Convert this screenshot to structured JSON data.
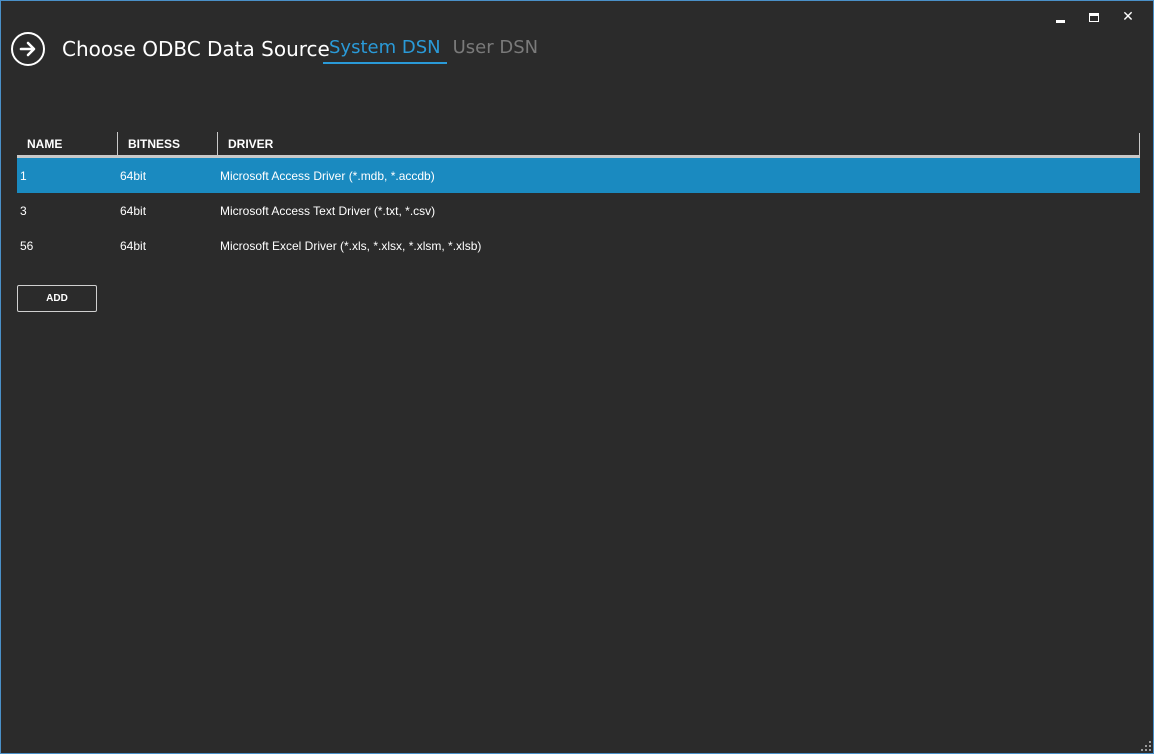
{
  "window": {
    "controls": {
      "minimize": "minimize",
      "maximize": "maximize",
      "close": "✕"
    }
  },
  "header": {
    "title": "Choose ODBC Data Source",
    "tabs": [
      {
        "label": "System DSN",
        "active": true
      },
      {
        "label": "User DSN",
        "active": false
      }
    ]
  },
  "table": {
    "columns": [
      "NAME",
      "BITNESS",
      "DRIVER"
    ],
    "rows": [
      {
        "name": "1",
        "bitness": "64bit",
        "driver": "Microsoft Access Driver (*.mdb, *.accdb)",
        "selected": true
      },
      {
        "name": "3",
        "bitness": "64bit",
        "driver": "Microsoft Access Text Driver (*.txt, *.csv)",
        "selected": false
      },
      {
        "name": "56",
        "bitness": "64bit",
        "driver": "Microsoft Excel Driver (*.xls, *.xlsx, *.xlsm, *.xlsb)",
        "selected": false
      }
    ]
  },
  "actions": {
    "add_label": "ADD"
  },
  "colors": {
    "accent": "#2a9ad8",
    "selection": "#1a8ac0",
    "background": "#2b2b2b"
  },
  "icons": {
    "back": "arrow-right-circle-icon"
  }
}
